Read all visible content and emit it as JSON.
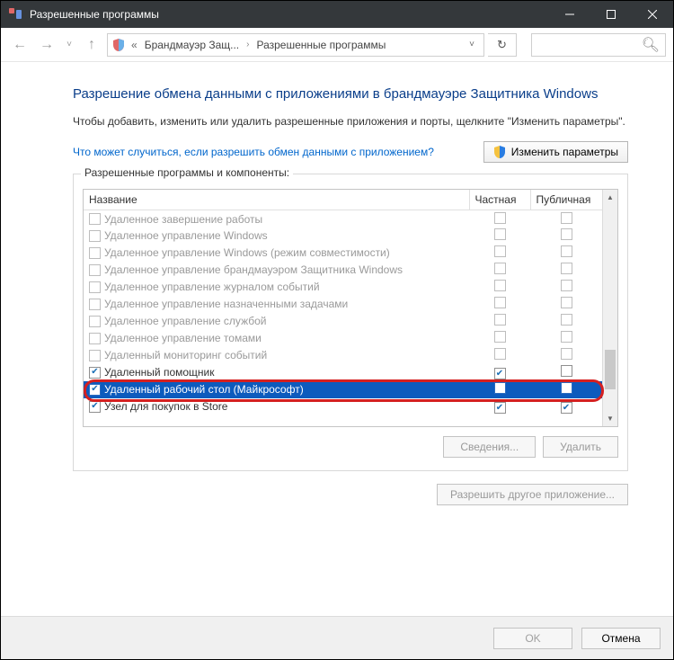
{
  "title": "Разрешенные программы",
  "breadcrumb": {
    "root": "Брандмауэр Защ...",
    "leaf": "Разрешенные программы"
  },
  "heading": "Разрешение обмена данными с приложениями в брандмауэре Защитника Windows",
  "instruction": "Чтобы добавить, изменить или удалить разрешенные приложения и порты, щелкните \"Изменить параметры\".",
  "helpLink": "Что может случиться, если разрешить обмен данными с приложением?",
  "changeParamsBtn": "Изменить параметры",
  "legend": "Разрешенные программы и компоненты:",
  "columns": {
    "name": "Название",
    "priv": "Частная",
    "pub": "Публичная"
  },
  "rows": [
    {
      "name": "Удаленное завершение работы",
      "en": false,
      "priv": false,
      "pub": false
    },
    {
      "name": "Удаленное управление Windows",
      "en": false,
      "priv": false,
      "pub": false
    },
    {
      "name": "Удаленное управление Windows (режим совместимости)",
      "en": false,
      "priv": false,
      "pub": false
    },
    {
      "name": "Удаленное управление брандмауэром Защитника Windows",
      "en": false,
      "priv": false,
      "pub": false
    },
    {
      "name": "Удаленное управление журналом событий",
      "en": false,
      "priv": false,
      "pub": false
    },
    {
      "name": "Удаленное управление назначенными задачами",
      "en": false,
      "priv": false,
      "pub": false
    },
    {
      "name": "Удаленное управление службой",
      "en": false,
      "priv": false,
      "pub": false
    },
    {
      "name": "Удаленное управление томами",
      "en": false,
      "priv": false,
      "pub": false
    },
    {
      "name": "Удаленный мониторинг событий",
      "en": false,
      "priv": false,
      "pub": false
    },
    {
      "name": "Удаленный помощник",
      "en": true,
      "priv": true,
      "pub": false,
      "enabled_color": true
    },
    {
      "name": "Удаленный рабочий стол (Майкрософт)",
      "en": true,
      "priv": false,
      "pub": false,
      "selected": true
    },
    {
      "name": "Узел для покупок в Store",
      "en": true,
      "priv": true,
      "pub": true,
      "enabled_color": true
    }
  ],
  "detailsBtn": "Сведения...",
  "deleteBtn": "Удалить",
  "allowOtherBtn": "Разрешить другое приложение...",
  "okBtn": "OK",
  "cancelBtn": "Отмена"
}
